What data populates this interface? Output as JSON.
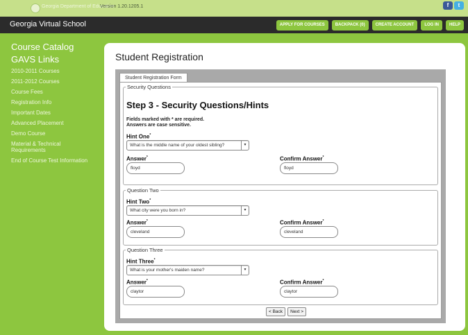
{
  "topbar": {
    "department_name": "Georgia Department of Education",
    "version": "Version 1.20.1205.1",
    "social": [
      {
        "icon": "facebook-icon",
        "glyph": "f"
      },
      {
        "icon": "twitter-icon",
        "glyph": "t"
      }
    ]
  },
  "header": {
    "school_name": "Georgia Virtual School",
    "nav": [
      {
        "label": "APPLY FOR COURSES"
      },
      {
        "label": "BACKPACK (0)"
      },
      {
        "label": "CREATE ACCOUNT"
      },
      {
        "label": "LOG IN"
      },
      {
        "label": "HELP"
      }
    ]
  },
  "sidebar": {
    "title1": "Course Catalog",
    "title2": "GAVS Links",
    "items": [
      "2010-2011 Courses",
      "2011-2012 Courses",
      "Course Fees",
      "Registration Info",
      "Important Dates",
      "Advanced Placement",
      "Demo Course",
      "Material & Technical Requirements",
      "End of Course Test Information"
    ]
  },
  "main": {
    "title": "Student Registration",
    "tab": "Student Registration Form",
    "step_title": "Step 3 - Security Questions/Hints",
    "note1": "Fields marked with * are required.",
    "note2": "Answers are case sensitive.",
    "sections": [
      {
        "legend": "Security Questions",
        "hint_label": "Hint One",
        "hint_value": "What is the middle name of your oldest sibling?",
        "answer_label": "Answer",
        "answer_value": "floyd",
        "confirm_label": "Confirm Answer",
        "confirm_value": "floyd"
      },
      {
        "legend": "Question Two",
        "hint_label": "Hint Two",
        "hint_value": "What city were you born in?",
        "answer_label": "Answer",
        "answer_value": "cleveland",
        "confirm_label": "Confirm Answer",
        "confirm_value": "cleveland"
      },
      {
        "legend": "Question Three",
        "hint_label": "Hint Three",
        "hint_value": "What is your mother's maiden name?",
        "answer_label": "Answer",
        "answer_value": "claytor",
        "confirm_label": "Confirm Answer",
        "confirm_value": "claytor"
      }
    ],
    "required_mark": "*",
    "back_label": "< Back",
    "next_label": "Next >"
  },
  "colors": {
    "brand_green": "#8dc63f",
    "header_dark": "#2b2b2b",
    "form_gray": "#a9a9a9"
  }
}
